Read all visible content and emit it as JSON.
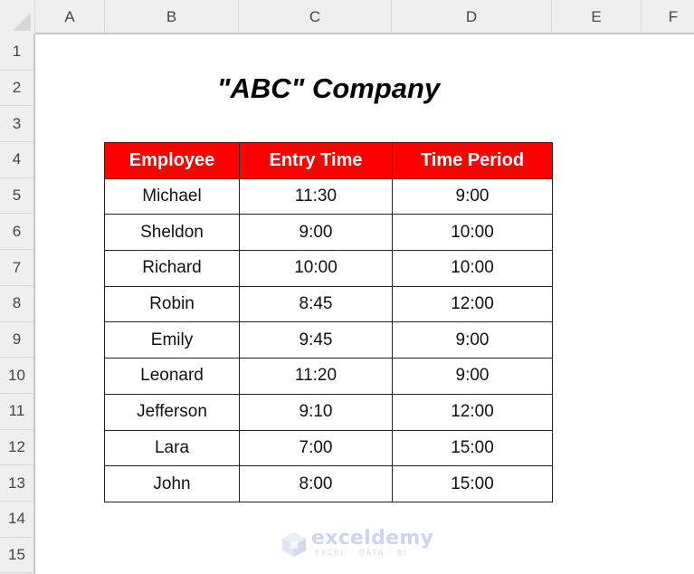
{
  "spreadsheet": {
    "columns": [
      "A",
      "B",
      "C",
      "D",
      "E",
      "F"
    ],
    "rows": [
      "1",
      "2",
      "3",
      "4",
      "5",
      "6",
      "7",
      "8",
      "9",
      "10",
      "11",
      "12",
      "13",
      "14",
      "15"
    ]
  },
  "title": "\"ABC\" Company",
  "table": {
    "headers": [
      "Employee",
      "Entry Time",
      "Time Period"
    ],
    "rows": [
      [
        "Michael",
        "11:30",
        "9:00"
      ],
      [
        "Sheldon",
        "9:00",
        "10:00"
      ],
      [
        "Richard",
        "10:00",
        "10:00"
      ],
      [
        "Robin",
        "8:45",
        "12:00"
      ],
      [
        "Emily",
        "9:45",
        "9:00"
      ],
      [
        "Leonard",
        "11:20",
        "9:00"
      ],
      [
        "Jefferson",
        "9:10",
        "12:00"
      ],
      [
        "Lara",
        "7:00",
        "15:00"
      ],
      [
        "John",
        "8:00",
        "15:00"
      ]
    ]
  },
  "watermark": {
    "name": "exceldemy",
    "tagline": "EXCEL · DATA · BI"
  },
  "colors": {
    "header_fill": "#ff0000",
    "header_text": "#ffffff"
  }
}
